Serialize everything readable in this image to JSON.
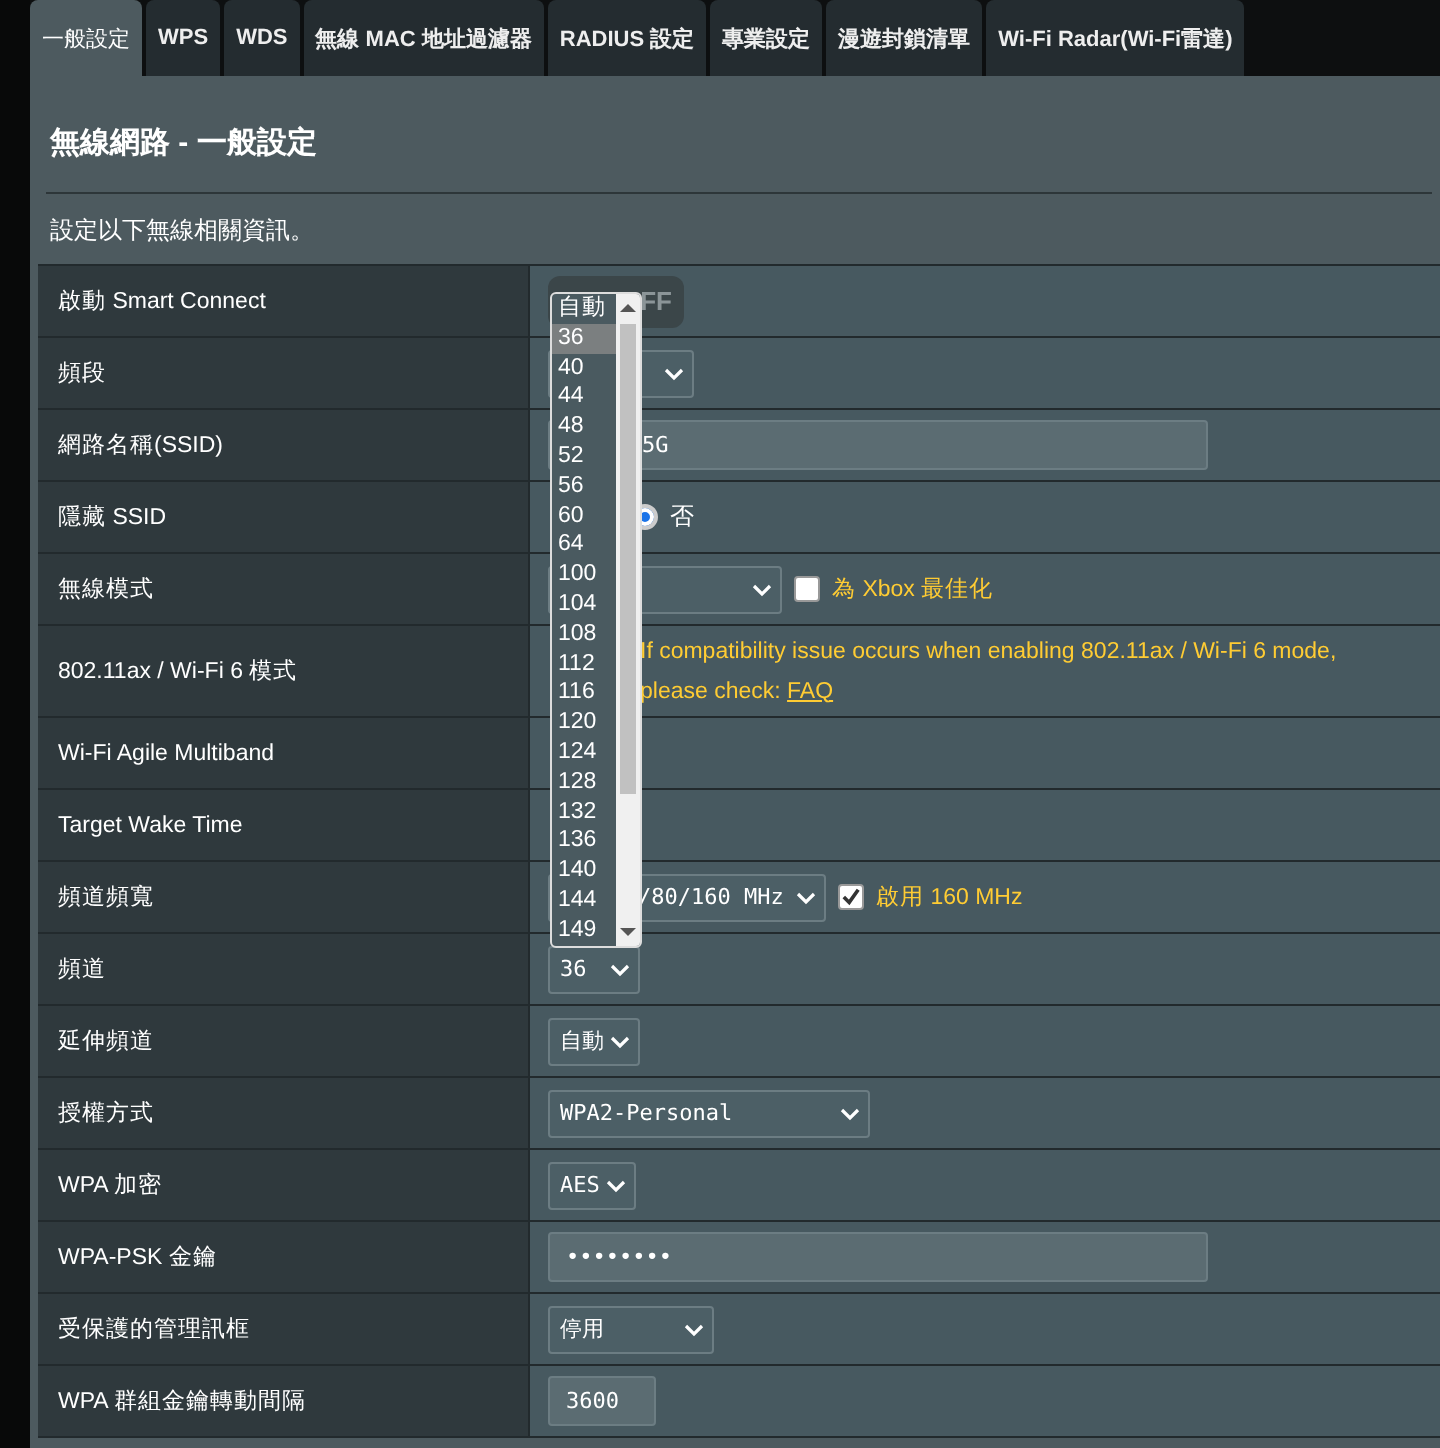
{
  "tabs": [
    {
      "label": "一般設定",
      "selected": true
    },
    {
      "label": "WPS",
      "selected": false
    },
    {
      "label": "WDS",
      "selected": false
    },
    {
      "label": "無線 MAC 地址過濾器",
      "selected": false
    },
    {
      "label": "RADIUS 設定",
      "selected": false
    },
    {
      "label": "專業設定",
      "selected": false
    },
    {
      "label": "漫遊封鎖清單",
      "selected": false
    },
    {
      "label": "Wi-Fi Radar(Wi-Fi雷達)",
      "selected": false
    }
  ],
  "title": "無線網路 - 一般設定",
  "description": "設定以下無線相關資訊。",
  "rows": [
    {
      "label": "啟動 Smart Connect",
      "kind": "toggle",
      "value": "FF",
      "on": false
    },
    {
      "label": "頻段",
      "kind": "select"
    },
    {
      "label": "網路名稱(SSID)",
      "kind": "input",
      "value": "5G"
    },
    {
      "label": "隱藏 SSID",
      "kind": "radio",
      "value": "否",
      "selected": true
    },
    {
      "label": "無線模式",
      "kind": "select",
      "checkbox": {
        "label": "為 Xbox 最佳化",
        "checked": false
      }
    },
    {
      "label": "802.11ax / Wi-Fi 6 模式",
      "kind": "notice",
      "text": "If compatibility issue occurs when enabling 802.11ax / Wi-Fi 6 mode, please check:",
      "link": "FAQ"
    },
    {
      "label": "Wi-Fi Agile Multiband",
      "kind": "empty"
    },
    {
      "label": "Target Wake Time",
      "kind": "empty"
    },
    {
      "label": "頻道頻寬",
      "kind": "select",
      "value": "/80/160 MHz",
      "checkbox": {
        "label": "啟用 160 MHz",
        "checked": true
      }
    },
    {
      "label": "頻道",
      "kind": "select",
      "value": "36"
    },
    {
      "label": "延伸頻道",
      "kind": "select",
      "value": "自動"
    },
    {
      "label": "授權方式",
      "kind": "select",
      "value": "WPA2-Personal"
    },
    {
      "label": "WPA 加密",
      "kind": "select",
      "value": "AES"
    },
    {
      "label": "WPA-PSK 金鑰",
      "kind": "input",
      "value": "••••••••"
    },
    {
      "label": "受保護的管理訊框",
      "kind": "select",
      "value": "停用"
    },
    {
      "label": "WPA 群組金鑰轉動間隔",
      "kind": "short-input",
      "value": "3600"
    }
  ],
  "dropdown": {
    "options": [
      {
        "label": "自動",
        "selected": false
      },
      {
        "label": "36",
        "selected": true
      },
      {
        "label": "40",
        "selected": false
      },
      {
        "label": "44",
        "selected": false
      },
      {
        "label": "48",
        "selected": false
      },
      {
        "label": "52",
        "selected": false
      },
      {
        "label": "56",
        "selected": false
      },
      {
        "label": "60",
        "selected": false
      },
      {
        "label": "64",
        "selected": false
      },
      {
        "label": "100",
        "selected": false
      },
      {
        "label": "104",
        "selected": false
      },
      {
        "label": "108",
        "selected": false
      },
      {
        "label": "112",
        "selected": false
      },
      {
        "label": "116",
        "selected": false
      },
      {
        "label": "120",
        "selected": false
      },
      {
        "label": "124",
        "selected": false
      },
      {
        "label": "128",
        "selected": false
      },
      {
        "label": "132",
        "selected": false
      },
      {
        "label": "136",
        "selected": false
      },
      {
        "label": "140",
        "selected": false
      },
      {
        "label": "144",
        "selected": false
      },
      {
        "label": "149",
        "selected": false
      }
    ]
  }
}
